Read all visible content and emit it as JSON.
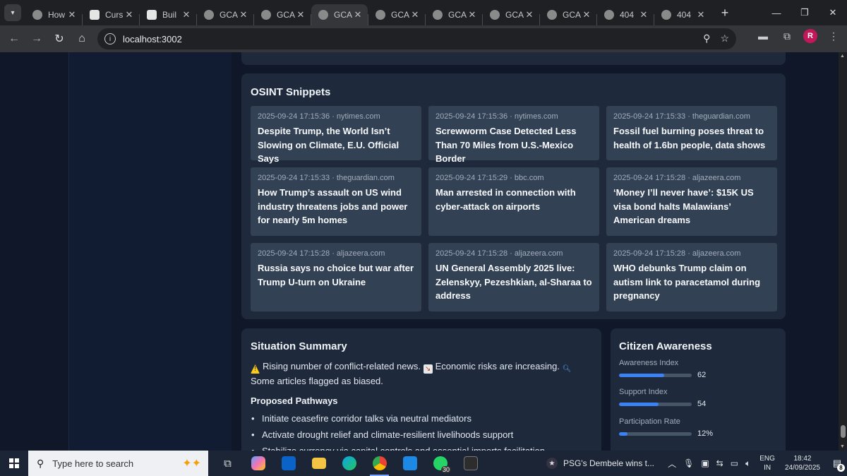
{
  "browser": {
    "tabs": [
      {
        "title": "How",
        "icon": "openai-icon",
        "active": false
      },
      {
        "title": "Curs",
        "icon": "cursor-icon",
        "active": false
      },
      {
        "title": "Buil",
        "icon": "cursor-icon",
        "active": false
      },
      {
        "title": "GCA",
        "icon": "github-icon",
        "active": false
      },
      {
        "title": "GCA",
        "icon": "globe-icon",
        "active": false
      },
      {
        "title": "GCA",
        "icon": "globe-icon",
        "active": true
      },
      {
        "title": "GCA",
        "icon": "globe-icon",
        "active": false
      },
      {
        "title": "GCA",
        "icon": "globe-icon",
        "active": false
      },
      {
        "title": "GCA",
        "icon": "globe-icon",
        "active": false
      },
      {
        "title": "GCA",
        "icon": "github-icon",
        "active": false
      },
      {
        "title": "404",
        "icon": "globe-icon",
        "active": false
      },
      {
        "title": "404",
        "icon": "globe-icon",
        "active": false
      }
    ],
    "url": "localhost:3002",
    "profile_initial": "R"
  },
  "osint": {
    "heading": "OSINT Snippets",
    "snippets": [
      {
        "meta": "2025-09-24 17:15:36 · nytimes.com",
        "title": "Despite Trump, the World Isn’t Slowing on Climate, E.U. Official Says"
      },
      {
        "meta": "2025-09-24 17:15:36 · nytimes.com",
        "title": "Screwworm Case Detected Less Than 70 Miles from U.S.-Mexico Border"
      },
      {
        "meta": "2025-09-24 17:15:33 · theguardian.com",
        "title": "Fossil fuel burning poses threat to health of 1.6bn people, data shows"
      },
      {
        "meta": "2025-09-24 17:15:33 · theguardian.com",
        "title": "How Trump’s assault on US wind industry threatens jobs and power for nearly 5m homes"
      },
      {
        "meta": "2025-09-24 17:15:29 · bbc.com",
        "title": "Man arrested in connection with cyber-attack on airports"
      },
      {
        "meta": "2025-09-24 17:15:28 · aljazeera.com",
        "title": "‘Money I’ll never have’: $15K US visa bond halts Malawians’ American dreams"
      },
      {
        "meta": "2025-09-24 17:15:28 · aljazeera.com",
        "title": "Russia says no choice but war after Trump U-turn on Ukraine"
      },
      {
        "meta": "2025-09-24 17:15:28 · aljazeera.com",
        "title": "UN General Assembly 2025 live: Zelenskyy, Pezeshkian, al-Sharaa to address"
      },
      {
        "meta": "2025-09-24 17:15:28 · aljazeera.com",
        "title": "WHO debunks Trump claim on autism link to paracetamol during pregnancy"
      }
    ]
  },
  "situation": {
    "heading": "Situation Summary",
    "line1": "Rising number of conflict-related news.",
    "line2": "Economic risks are increasing.",
    "line3": "Some articles flagged as biased.",
    "pathways_heading": "Proposed Pathways",
    "pathways": [
      "Initiate ceasefire corridor talks via neutral mediators",
      "Activate drought relief and climate-resilient livelihoods support",
      "Stabilize currency via capital controls and essential imports facilitation"
    ]
  },
  "awareness": {
    "heading": "Citizen Awareness",
    "metrics": [
      {
        "label": "Awareness Index",
        "value": "62",
        "fraction": 0.62
      },
      {
        "label": "Support Index",
        "value": "54",
        "fraction": 0.54
      },
      {
        "label": "Participation Rate",
        "value": "12%",
        "fraction": 0.12
      }
    ]
  },
  "taskbar": {
    "search_placeholder": "Type here to search",
    "whatsapp_badge": "30",
    "news_text": "PSG's Dembele wins t...",
    "lang_line1": "ENG",
    "lang_line2": "IN",
    "time": "18:42",
    "date": "24/09/2025",
    "notification_count": "8"
  },
  "colors": {
    "page_bg": "#0f1729",
    "card_bg": "#1e293b",
    "snippet_bg": "#334155",
    "accent": "#3b82f6"
  }
}
